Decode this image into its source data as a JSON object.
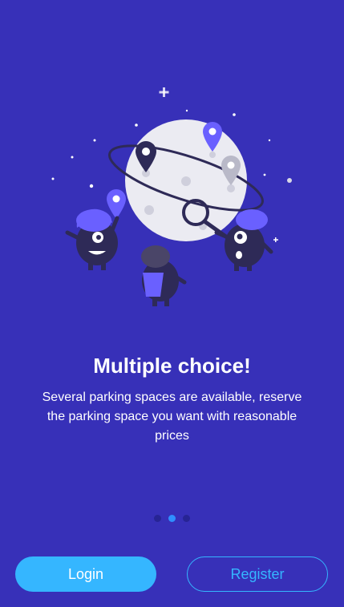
{
  "onboarding": {
    "title": "Multiple choice!",
    "description": "Several parking spaces are available, reserve the parking space you want with reasonable prices",
    "pagination": {
      "total": 3,
      "active_index": 1
    }
  },
  "actions": {
    "login_label": "Login",
    "register_label": "Register"
  },
  "colors": {
    "background": "#3730b8",
    "accent": "#35b6ff",
    "dot_active": "#2f8fff",
    "dot_inactive": "#272494",
    "monster_body": "#2e2a57",
    "monster_hat": "#6a60ff",
    "moon": "#ebebf2"
  },
  "icons": [
    "moon-illustration",
    "location-pin-icon",
    "magnifier-icon",
    "monster-character"
  ]
}
